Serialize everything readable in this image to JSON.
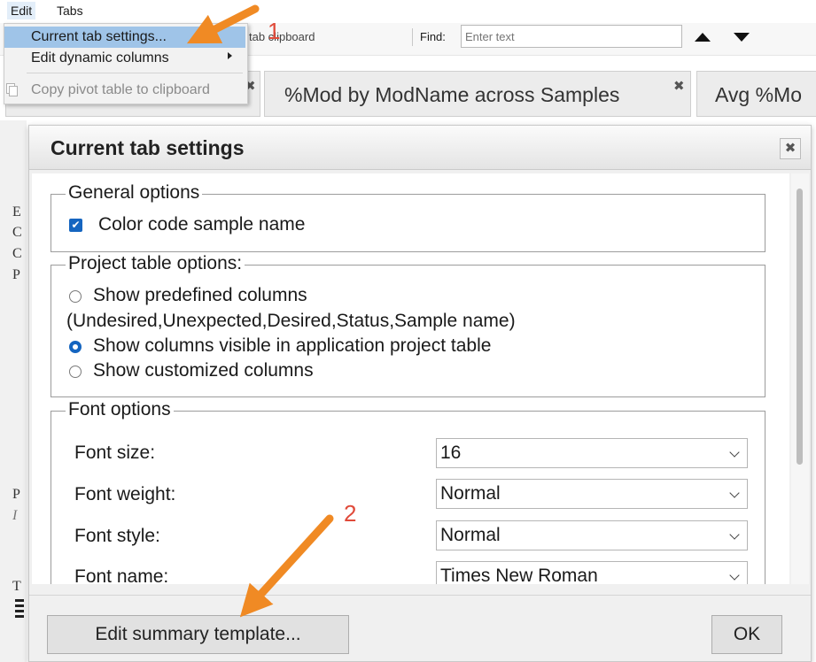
{
  "menubar": {
    "edit": "Edit",
    "tabs": "Tabs"
  },
  "toolbar": {
    "clipboard_text": "tab  clipboard",
    "find_label": "Find:",
    "find_placeholder": "Enter text"
  },
  "menu": {
    "items": [
      {
        "label": "Current tab settings..."
      },
      {
        "label": "Edit dynamic columns"
      },
      {
        "label": "Copy pivot table to clipboard"
      }
    ]
  },
  "tabs": [
    {
      "label": "%Mod by ModName across Samples"
    },
    {
      "label": "Avg %Mo"
    }
  ],
  "left_letters": [
    "E",
    "C",
    "C",
    "P",
    "P",
    "I",
    "T"
  ],
  "dialog": {
    "title": "Current tab settings",
    "general": {
      "legend": "General options",
      "color_code": "Color code sample name",
      "color_code_checked": true
    },
    "project": {
      "legend": "Project table options:",
      "predefined": "Show predefined columns",
      "predefined_note": "(Undesired,Unexpected,Desired,Status,Sample name)",
      "visible": "Show columns visible in application project table",
      "customized": "Show customized columns",
      "selected": "visible"
    },
    "font": {
      "legend": "Font options",
      "size_label": "Font size:",
      "size_value": "16",
      "weight_label": "Font weight:",
      "weight_value": "Normal",
      "style_label": "Font style:",
      "style_value": "Normal",
      "name_label": "Font name:",
      "name_value": "Times New Roman"
    },
    "edit_template_button": "Edit summary template...",
    "ok_button": "OK"
  },
  "annotations": {
    "badge1": "1",
    "badge2": "2",
    "arrow_color": "#f08a24",
    "badge_color": "#e04a3a"
  }
}
